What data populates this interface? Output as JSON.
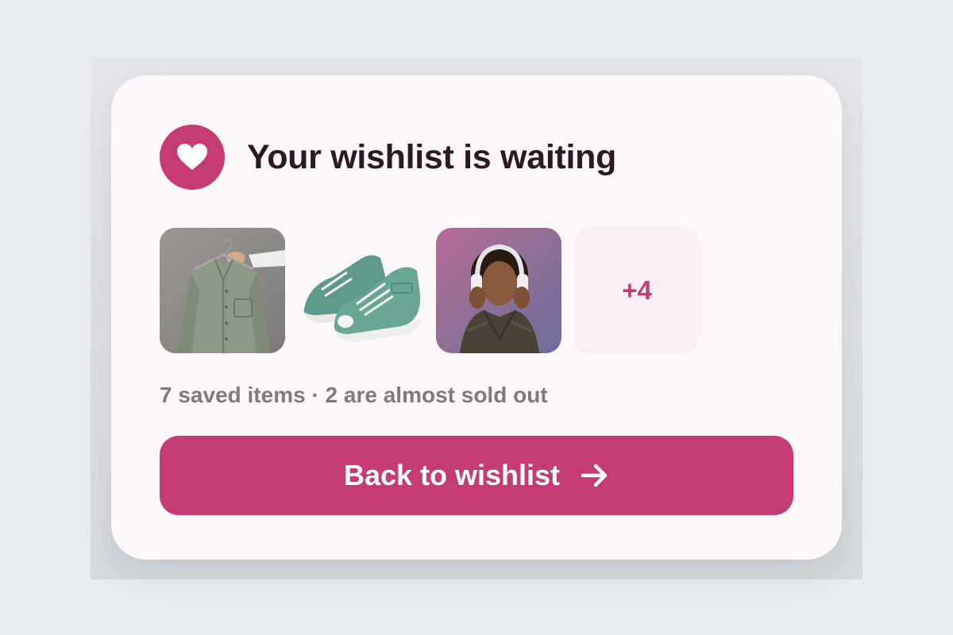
{
  "card": {
    "title": "Your wishlist is waiting",
    "heart_icon": "heart-icon",
    "accent_color": "#c63b73",
    "items": [
      {
        "name": "green shirt on hanger",
        "icon": "shirt-photo"
      },
      {
        "name": "green high-top sneakers",
        "icon": "sneakers-photo"
      },
      {
        "name": "woman with headphones",
        "icon": "headphones-photo"
      }
    ],
    "more_count": "+4",
    "summary": "7 saved items · 2 are almost sold out",
    "cta_label": "Back to wishlist",
    "cta_icon": "arrow-right-icon"
  }
}
